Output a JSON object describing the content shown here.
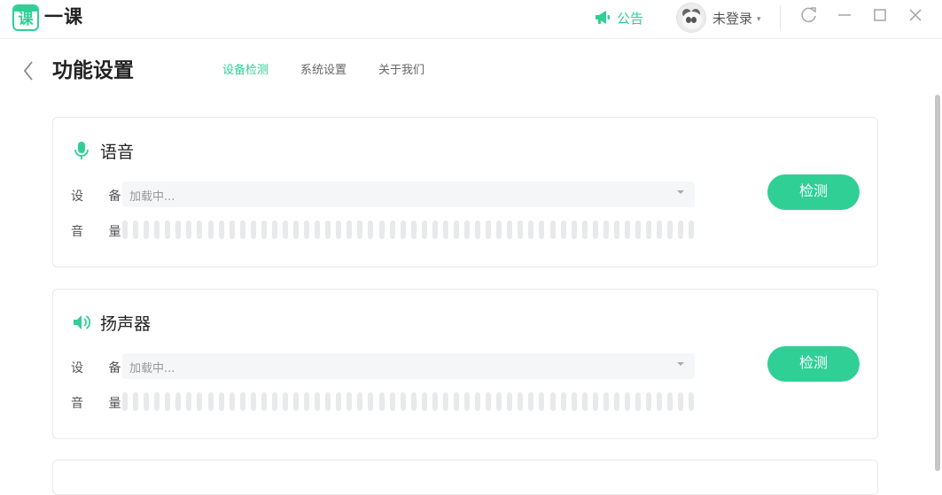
{
  "app": {
    "logo_glyph": "课",
    "name": "一课"
  },
  "titlebar": {
    "notice_label": "公告",
    "user_label": "未登录",
    "icons": [
      "megaphone-icon",
      "panda-avatar",
      "refresh-icon",
      "minimize-icon",
      "maximize-icon",
      "close-icon"
    ]
  },
  "page": {
    "title": "功能设置",
    "tabs": [
      {
        "label": "设备检测",
        "active": true
      },
      {
        "label": "系统设置",
        "active": false
      },
      {
        "label": "关于我们",
        "active": false
      }
    ]
  },
  "sections": [
    {
      "title": "语音",
      "icon": "microphone-icon",
      "device_label": "设 备",
      "device_value": "加载中...",
      "volume_label": "音 量",
      "volume_level": 0,
      "button_label": "检测"
    },
    {
      "title": "扬声器",
      "icon": "speaker-icon",
      "device_label": "设 备",
      "device_value": "加载中...",
      "volume_label": "音 量",
      "volume_level": 0,
      "button_label": "检测"
    }
  ],
  "colors": {
    "accent": "#2fcf95",
    "meter_idle": "#e8e9eb",
    "select_bg": "#f5f6f8"
  }
}
